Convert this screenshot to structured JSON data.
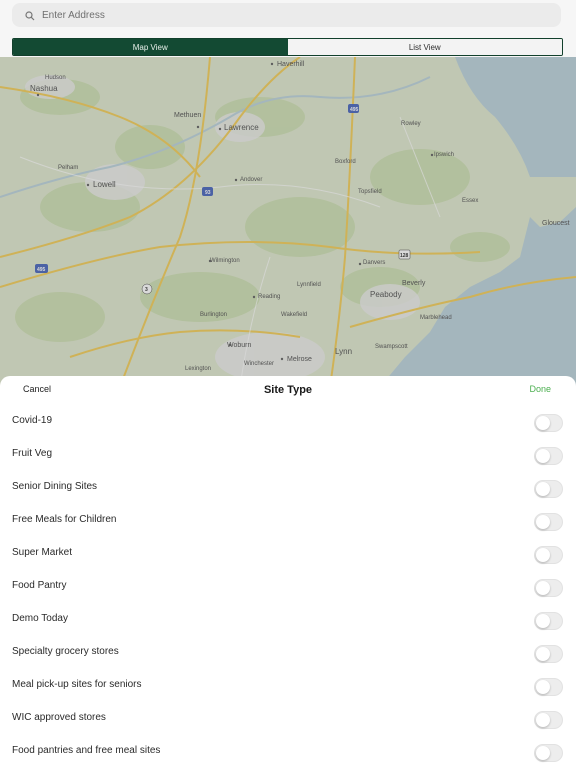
{
  "search": {
    "placeholder": "Enter Address"
  },
  "view_toggle": {
    "map_label": "Map View",
    "list_label": "List View",
    "selected": "Map View"
  },
  "map": {
    "places": [
      "Haverhill",
      "Nashua",
      "Hudson",
      "Methuen",
      "Lawrence",
      "Rowley",
      "Pelham",
      "Lowell",
      "Andover",
      "Boxford",
      "Ipswich",
      "Topsfield",
      "Essex",
      "Gloucest",
      "Wilmington",
      "Danvers",
      "Beverly",
      "Peabody",
      "Reading",
      "Burlington",
      "Wakefield",
      "Lynnfield",
      "Marblehead",
      "Woburn",
      "Melrose",
      "Lynn",
      "Swampscott",
      "Lexington",
      "Winchester"
    ],
    "shields": [
      "495",
      "93",
      "128",
      "3",
      "495"
    ]
  },
  "sheet": {
    "cancel_label": "Cancel",
    "title": "Site Type",
    "done_label": "Done",
    "options": [
      {
        "label": "Covid-19",
        "enabled": false
      },
      {
        "label": "Fruit Veg",
        "enabled": false
      },
      {
        "label": "Senior Dining Sites",
        "enabled": false
      },
      {
        "label": "Free Meals for Children",
        "enabled": false
      },
      {
        "label": "Super Market",
        "enabled": false
      },
      {
        "label": "Food Pantry",
        "enabled": false
      },
      {
        "label": "Demo Today",
        "enabled": false
      },
      {
        "label": "Specialty grocery stores",
        "enabled": false
      },
      {
        "label": "Meal pick-up sites for seniors",
        "enabled": false
      },
      {
        "label": "WIC approved stores",
        "enabled": false
      },
      {
        "label": "Food pantries and free meal sites",
        "enabled": false
      }
    ]
  },
  "colors": {
    "accent": "#134a33",
    "done": "#4caf50",
    "map_land": "#dfe6cf",
    "map_water": "#b8d2dc"
  }
}
